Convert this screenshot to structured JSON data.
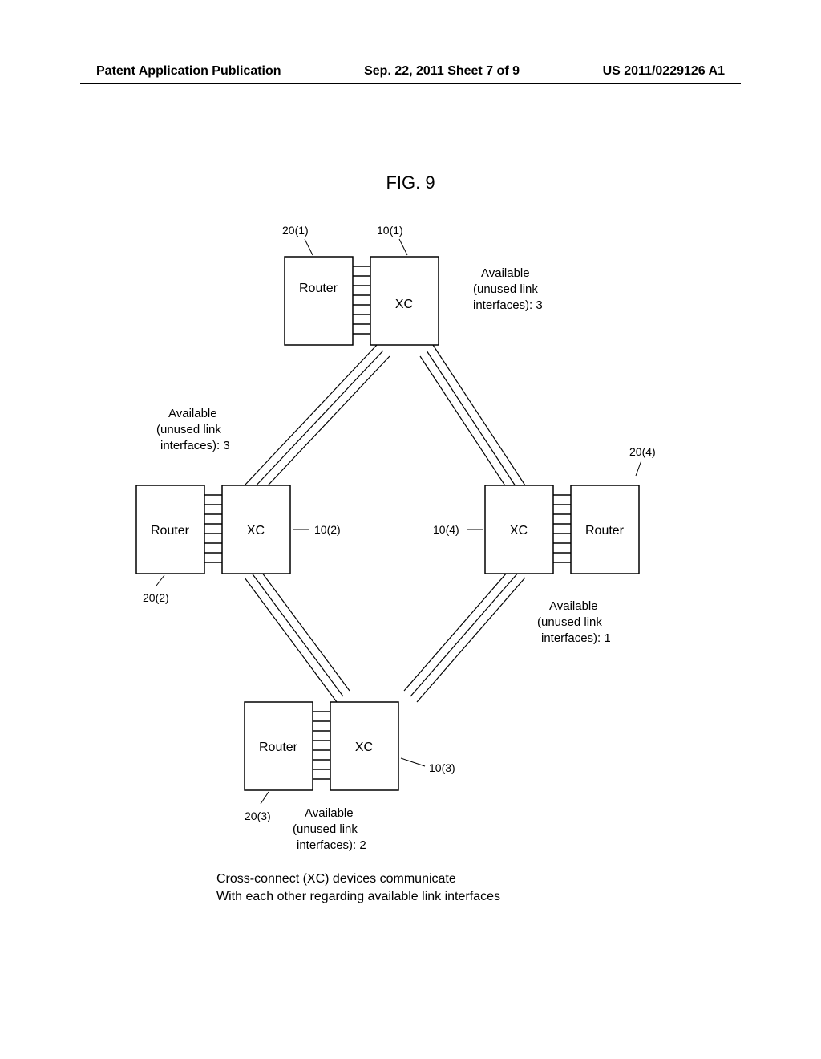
{
  "header": {
    "left": "Patent Application Publication",
    "center": "Sep. 22, 2011  Sheet 7 of 9",
    "right": "US 2011/0229126 A1"
  },
  "figure": {
    "title": "FIG. 9",
    "caption_line1": "Cross-connect (XC) devices communicate",
    "caption_line2": "With each other regarding available link interfaces"
  },
  "nodes": {
    "top": {
      "router_label": "Router",
      "xc_label": "XC",
      "router_ref": "20(1)",
      "xc_ref": "10(1)",
      "avail_l1": "Available",
      "avail_l2": "(unused link",
      "avail_l3": "interfaces): 3"
    },
    "left": {
      "router_label": "Router",
      "xc_label": "XC",
      "router_ref": "20(2)",
      "xc_ref": "10(2)",
      "avail_l1": "Available",
      "avail_l2": "(unused link",
      "avail_l3": "interfaces): 3"
    },
    "right": {
      "router_label": "Router",
      "xc_label": "XC",
      "router_ref": "20(4)",
      "xc_ref": "10(4)",
      "avail_l1": "Available",
      "avail_l2": "(unused link",
      "avail_l3": "interfaces): 1"
    },
    "bottom": {
      "router_label": "Router",
      "xc_label": "XC",
      "router_ref": "20(3)",
      "xc_ref": "10(3)",
      "avail_l1": "Available",
      "avail_l2": "(unused link",
      "avail_l3": "interfaces): 2"
    }
  }
}
